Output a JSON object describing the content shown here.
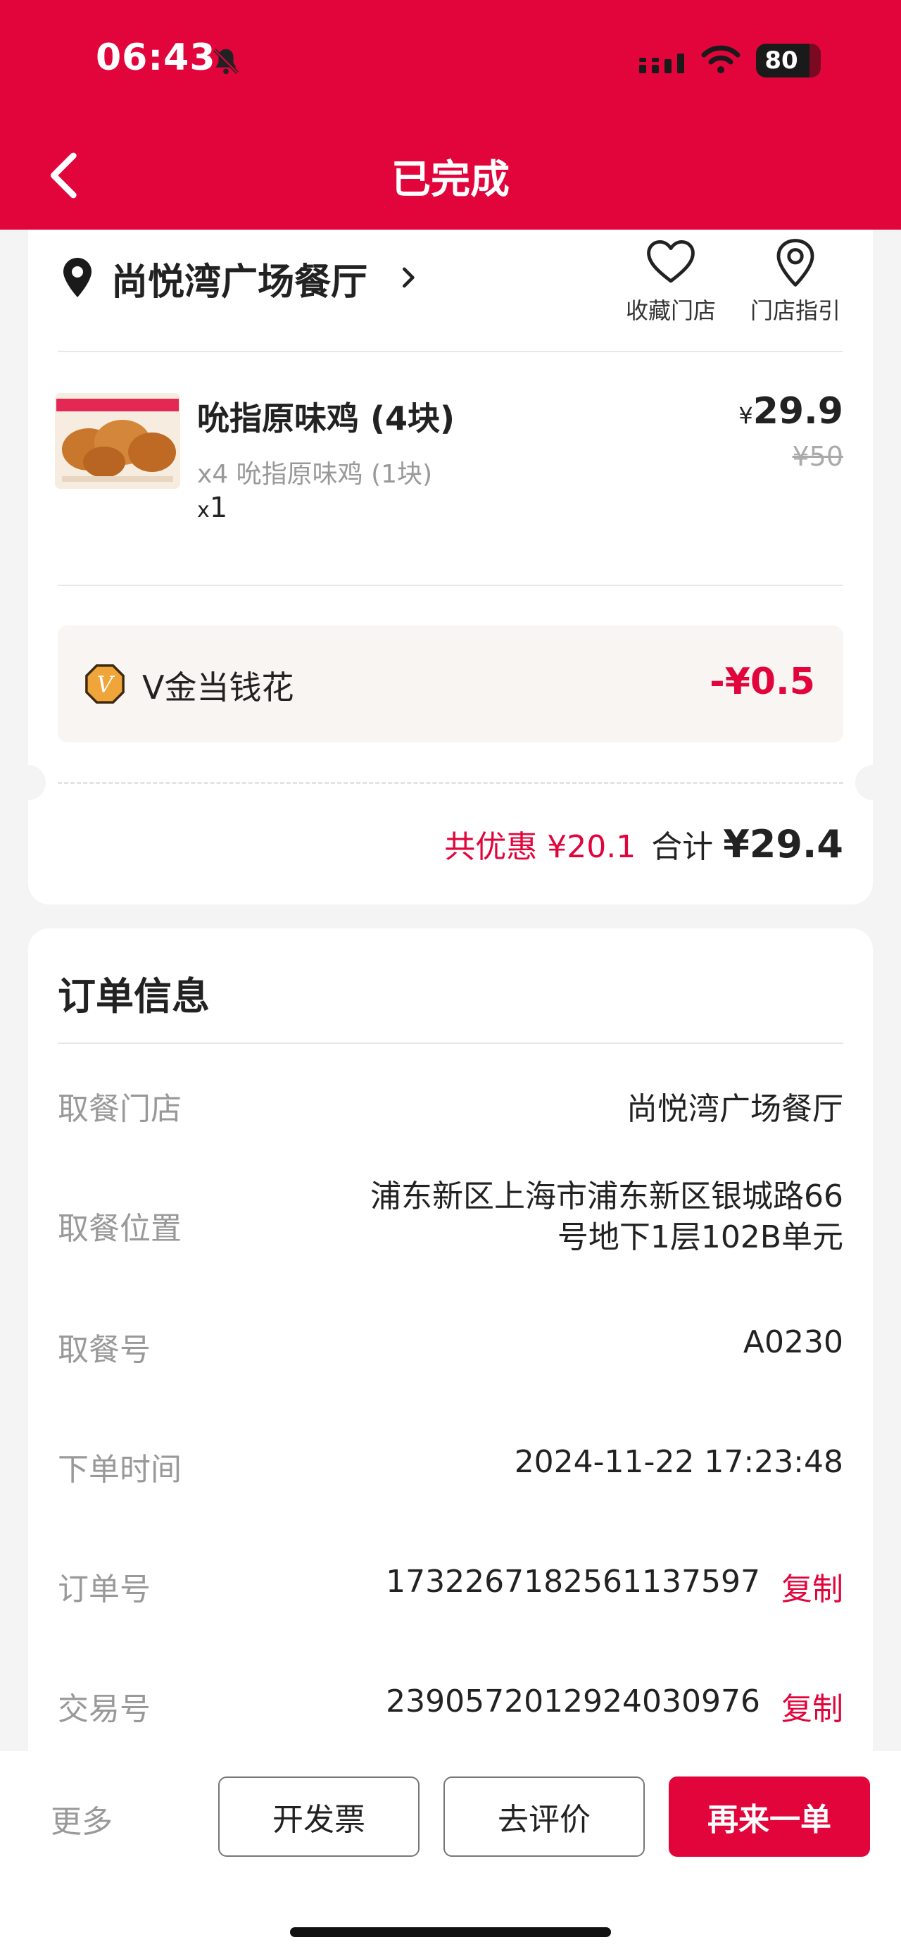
{
  "status_bar": {
    "time": "06:43",
    "battery": "80"
  },
  "header": {
    "title": "已完成"
  },
  "store": {
    "name": "尚悦湾广场餐厅",
    "favorite_label": "收藏门店",
    "guide_label": "门店指引"
  },
  "item": {
    "name": "吮指原味鸡 (4块)",
    "sub": "x4 吮指原味鸡 (1块)",
    "qty_prefix": "x",
    "qty": "1",
    "price_symbol": "¥",
    "price": "29.9",
    "original_price": "¥50"
  },
  "vgold": {
    "label": "V金当钱花",
    "amount": "-¥0.5"
  },
  "totals": {
    "discount": "共优惠 ¥20.1",
    "total_label": "合计",
    "total_value": "¥29.4"
  },
  "order_info": {
    "title": "订单信息",
    "copy_label": "复制",
    "rows": [
      {
        "label": "取餐门店",
        "value": "尚悦湾广场餐厅"
      },
      {
        "label": "取餐位置",
        "value_line1": "浦东新区上海市浦东新区银城路66",
        "value_line2": "号地下1层102B单元"
      },
      {
        "label": "取餐号",
        "value": "A0230"
      },
      {
        "label": "下单时间",
        "value": "2024-11-22 17:23:48"
      },
      {
        "label": "订单号",
        "value": "1732267182561137597"
      },
      {
        "label": "交易号",
        "value": "2390572012924030976"
      }
    ]
  },
  "bottom_bar": {
    "more": "更多",
    "invoice": "开发票",
    "review": "去评价",
    "reorder": "再来一单"
  },
  "colors": {
    "brand": "#e2053c",
    "muted": "#999999",
    "background": "#f4f4f4"
  }
}
